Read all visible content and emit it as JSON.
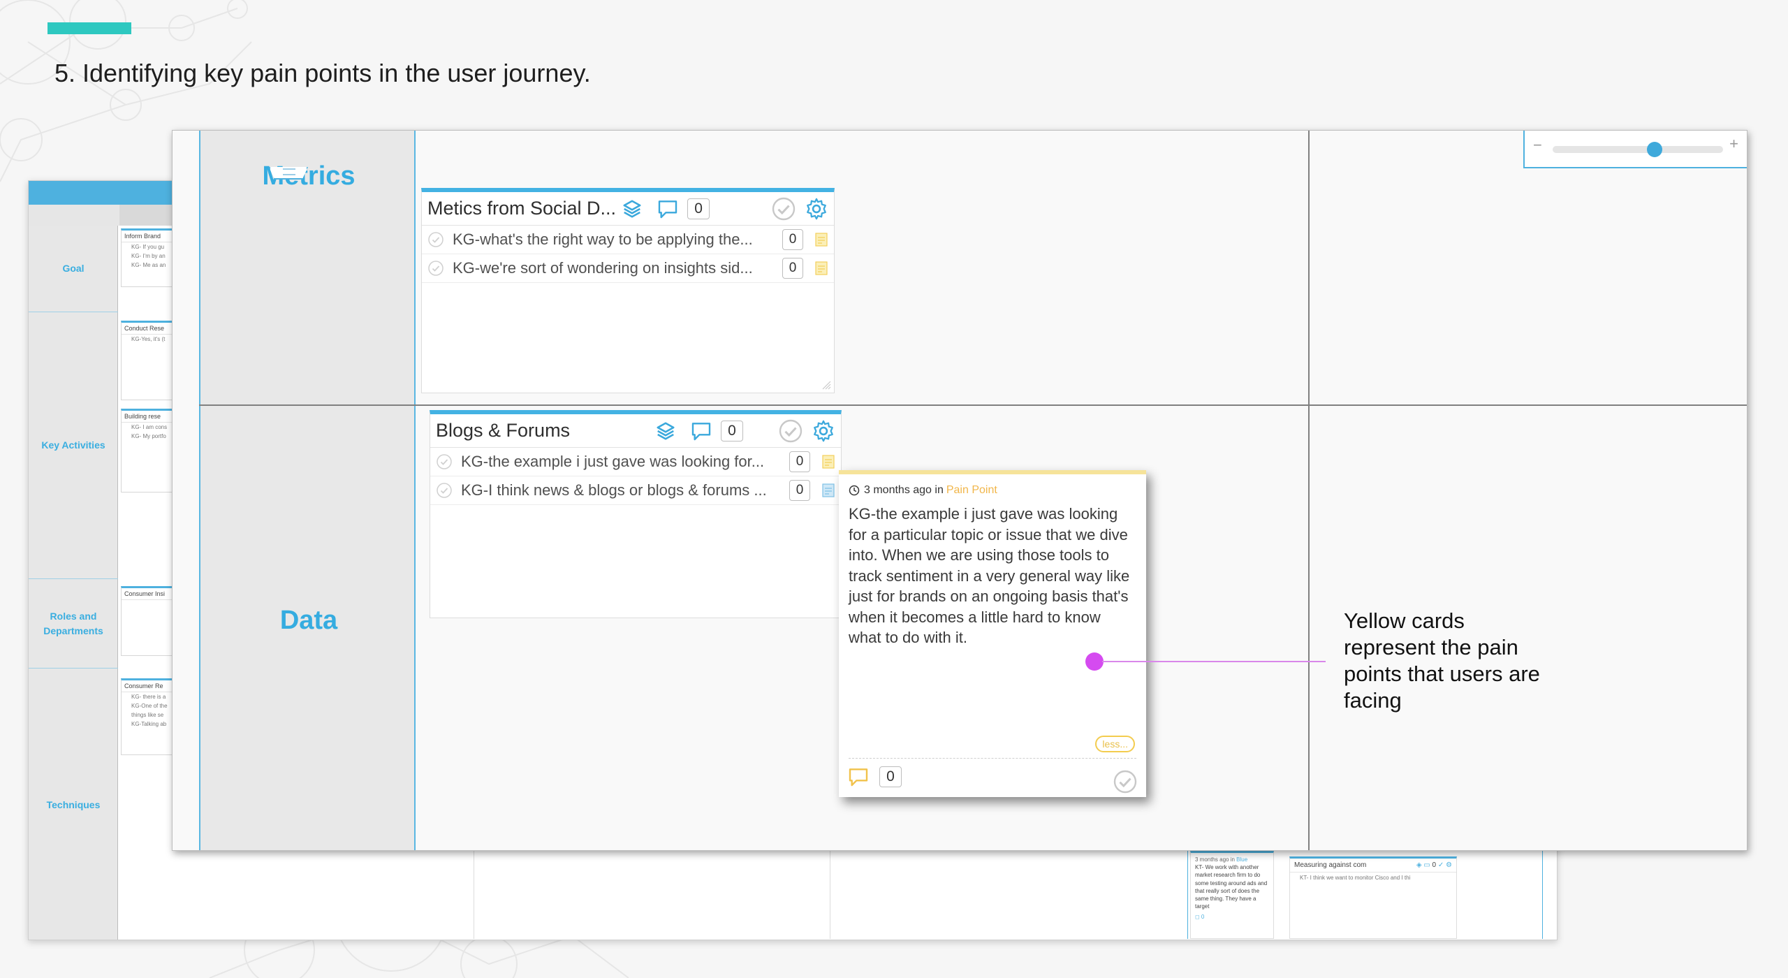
{
  "slide": {
    "title": "5. Identifying key pain points in the user journey."
  },
  "back_board": {
    "rows": [
      {
        "label": "Goal"
      },
      {
        "label": "Key Activities"
      },
      {
        "label": "Roles and Departments"
      },
      {
        "label": "Techniques"
      }
    ],
    "mini_cards": [
      {
        "title": "Inform Brand",
        "lines": [
          "KG- If you gu",
          "KG- I'm by an",
          "KG- Me as an"
        ]
      },
      {
        "title": "Conduct Rese",
        "lines": [
          "KG-Yes, it's (t"
        ]
      },
      {
        "title": "Building rese",
        "lines": [
          "KG- I am cons",
          "KG- My portfo"
        ]
      },
      {
        "title": "Consumer Insi",
        "lines": []
      },
      {
        "title": "Consumer Re",
        "lines": [
          "KG- there is a",
          "KG-One of the",
          "things like se",
          "KG-Talking ab"
        ]
      }
    ],
    "yellow_mini": {
      "meta": "3 months ago in",
      "tag": "Blue",
      "text": "KT- We work with another market research firm to do some testing around ads and that really sort of does the same thing. They have a target",
      "count": "0"
    },
    "blue_mini": {
      "title": "Measuring against com",
      "count": "0",
      "line": "KT- I think we want to monitor Cisco and I thi"
    }
  },
  "board": {
    "rows": [
      {
        "label": "Metrics"
      },
      {
        "label": "Data"
      }
    ],
    "zoom": {
      "minus": "−",
      "plus": "+",
      "level": 0.6
    },
    "cards": [
      {
        "title": "Metics from Social D...",
        "count": "0",
        "lines": [
          {
            "text": "KG-what's the right way to be applying the...",
            "count": "0"
          },
          {
            "text": "KG-we're sort of wondering on insights sid...",
            "count": "0"
          }
        ]
      },
      {
        "title": "Blogs & Forums",
        "count": "0",
        "lines": [
          {
            "text": "KG-the example i just gave was looking for...",
            "count": "0"
          },
          {
            "text": "KG-I think news & blogs or blogs & forums ...",
            "count": "0"
          }
        ]
      }
    ],
    "pain_card": {
      "meta": "3 months ago in",
      "tag": "Pain Point",
      "body": "KG-the example i just gave was looking for a particular topic or issue that we dive into. When we are using those tools to track sentiment in a very general way like just for brands on an ongoing basis that's when it becomes a little hard to know what to do with it.",
      "less_label": "less...",
      "count": "0"
    }
  },
  "annotation": {
    "text": "Yellow cards represent the pain points that users are facing"
  },
  "colors": {
    "accent": "#2ec8c0",
    "board_blue": "#43b2e3",
    "row_label": "#35ace0",
    "pain_yellow": "#f6e39a",
    "annotation_pink": "#d54bf0"
  }
}
